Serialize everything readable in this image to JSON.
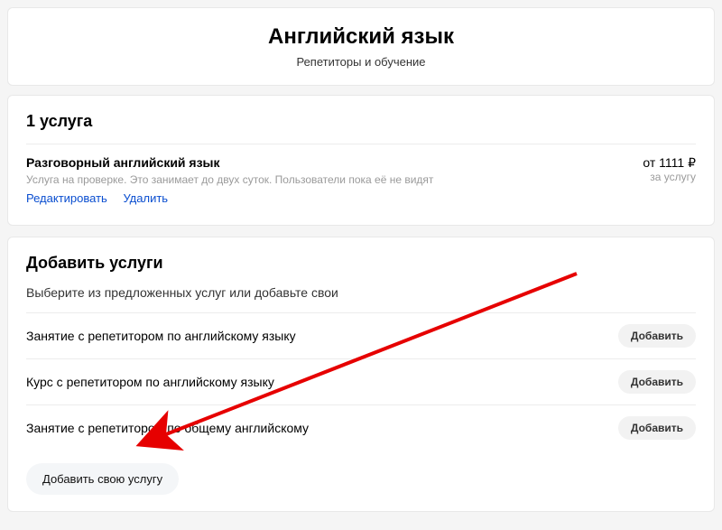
{
  "header": {
    "title": "Английский язык",
    "subtitle": "Репетиторы и обучение"
  },
  "services_card": {
    "title": "1 услуга",
    "items": [
      {
        "name": "Разговорный английский язык",
        "status": "Услуга на проверке. Это занимает до двух суток. Пользователи пока её не видят",
        "edit_label": "Редактировать",
        "delete_label": "Удалить",
        "price": "от 1111 ₽",
        "price_unit": "за услугу"
      }
    ]
  },
  "add_card": {
    "title": "Добавить услуги",
    "description": "Выберите из предложенных услуг или добавьте свои",
    "suggestions": [
      {
        "label": "Занятие с репетитором по английскому языку",
        "button": "Добавить"
      },
      {
        "label": "Курс с репетитором по английскому языку",
        "button": "Добавить"
      },
      {
        "label": "Занятие с репетитором по общему английскому",
        "button": "Добавить"
      }
    ],
    "custom_button": "Добавить свою услугу"
  }
}
